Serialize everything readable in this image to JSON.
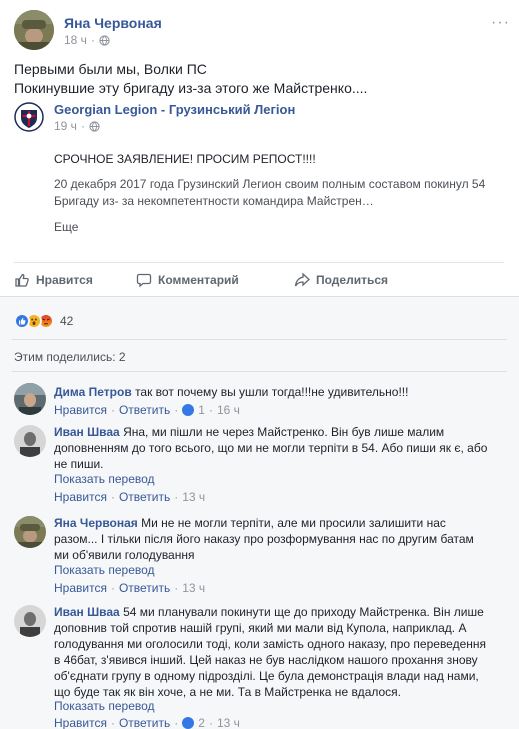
{
  "post": {
    "author": "Яна Червоная",
    "time": "18 ч",
    "more": "···",
    "text_line1": "Первыми были мы, Волки ПС",
    "text_line2": "Покинувшие эту бригаду из-за этого же Майстренко....",
    "shared": {
      "page_name": "Georgian Legion - Грузинський Легіон",
      "time": "19 ч",
      "title": "СРОЧНОЕ ЗАЯВЛЕНИЕ! ПРОСИМ РЕПОСТ!!!!",
      "body": "20 декабря 2017 года Грузинский Легион своим полным составом покинул 54 Бригаду из- за некомпетентности командира Майстрен…",
      "see_more": "Еще"
    },
    "actions": {
      "like": "Нравится",
      "comment": "Комментарий",
      "share": "Поделиться"
    }
  },
  "reactions": {
    "count": "42",
    "icons": [
      "like",
      "wow",
      "angry"
    ]
  },
  "shares_text": "Этим поделились: 2",
  "comments": [
    {
      "author": "Дима Петров",
      "text": "так вот почему вы ушли тогда!!!не удивительно!!!",
      "like": "Нравится",
      "reply": "Ответить",
      "likes": "1",
      "time": "16 ч"
    },
    {
      "author": "Иван Шваа",
      "text": "Яна, ми пішли не через Майстренко. Він був лише малим доповненням до того всього, що ми не могли терпіти в 54. Або пиши як є, або не пиши.",
      "translate": "Показать перевод",
      "like": "Нравится",
      "reply": "Ответить",
      "time": "13 ч"
    },
    {
      "author": "Яна Червоная",
      "text": "Ми не не могли терпіти, але ми просили залишити нас разом... І тільки після його наказу про розформування нас по другим батам ми об'явили голодування",
      "translate": "Показать перевод",
      "like": "Нравится",
      "reply": "Ответить",
      "time": "13 ч"
    },
    {
      "author": "Иван Шваа",
      "text": "54 ми планували покинути ще до приходу Майстренка. Він лише доповнив той спротив нашій групі, який ми мали від Купола, наприклад. А голодування ми оголосили тоді, коли замість одного наказу, про переведення в 46бат, з'явився інший. Цей наказ не був наслідком нашого прохання знову об'єднати групу в одному підрозділі. Це була демонстрація влади над нами, що буде так як він хоче, а не ми. Та в Майстренка не вдалося.",
      "translate": "Показать перевод",
      "like": "Нравится",
      "reply": "Ответить",
      "likes": "2",
      "time": "13 ч"
    }
  ],
  "colors": {
    "link": "#385898",
    "meta": "#90949c",
    "like_blue": "#3578e5",
    "wow_yellow": "#f7b125",
    "angry_red": "#e9710f"
  }
}
